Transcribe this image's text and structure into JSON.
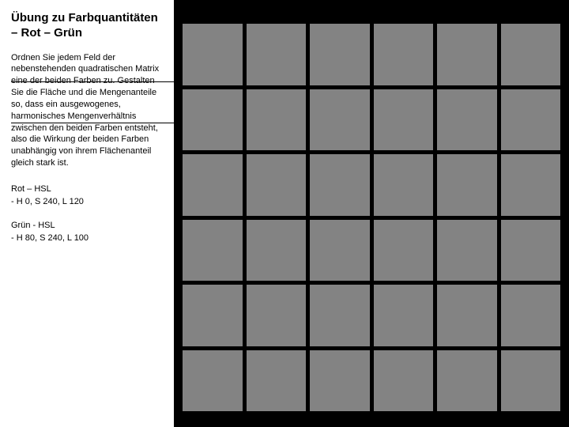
{
  "sidebar": {
    "heading": "Übung zu Farbquantitäten – Rot – Grün",
    "body": "Ordnen Sie jedem Feld der nebenstehenden quadratischen Matrix eine der beiden Farben zu. Gestalten Sie die Fläche und die Mengenanteile so, dass ein ausgewogenes, harmonisches Mengenverhältnis zwischen den beiden Farben entsteht, also die Wirkung der beiden Farben unabhängig von ihrem Flächenanteil gleich stark ist.",
    "color1_name": "Rot – HSL",
    "color1_values": "- H 0, S 240, L 120",
    "color2_name": "Grün - HSL",
    "color2_values": "- H 80, S 240, L 100"
  },
  "matrix": {
    "rows": 6,
    "cols": 6,
    "cell_count": 36,
    "cell_color": "#838383",
    "gap_color": "#000000"
  }
}
